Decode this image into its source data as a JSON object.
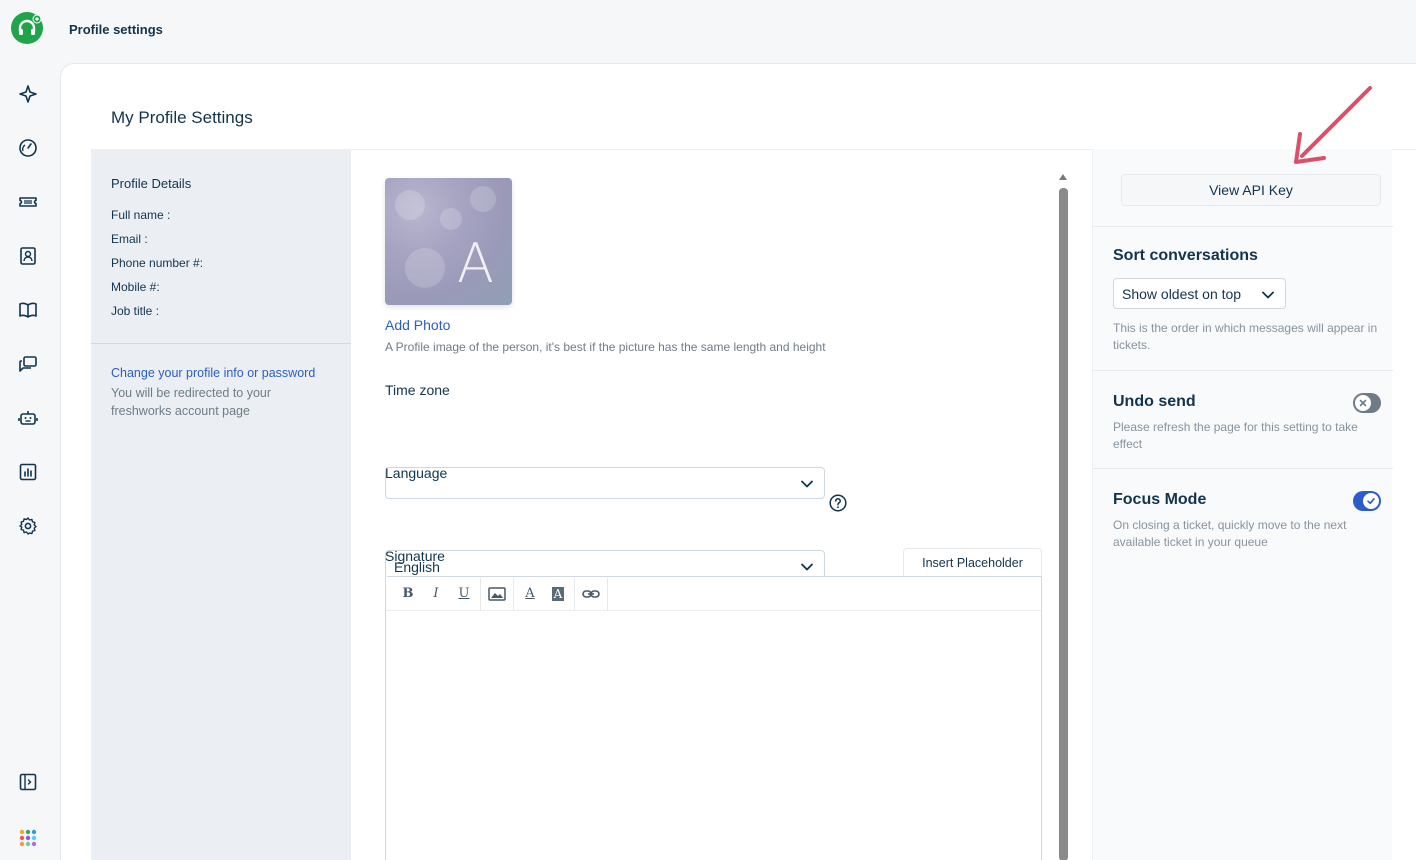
{
  "header": {
    "title": "Profile settings"
  },
  "page": {
    "heading": "My Profile Settings"
  },
  "profile_details": {
    "title": "Profile Details",
    "fields": [
      "Full name :",
      "Email :",
      "Phone number #:",
      "Mobile #:",
      "Job title :"
    ],
    "change_link": "Change your profile info or password",
    "redirect_note": "You will be redirected to your freshworks account page"
  },
  "photo": {
    "initial": "A",
    "add_label": "Add Photo",
    "hint": "A Profile image of the person, it's best if the picture has the same length and height"
  },
  "timezone": {
    "label": "Time zone",
    "value": ""
  },
  "language": {
    "label": "Language",
    "value": "English"
  },
  "signature": {
    "label": "Signature",
    "insert_placeholder": "Insert Placeholder",
    "toolbar": {
      "bold": "B",
      "italic": "I",
      "underline": "U",
      "font_color": "A",
      "bg_color": "A"
    }
  },
  "settings": {
    "api_key_button": "View API Key",
    "sort": {
      "title": "Sort conversations",
      "value": "Show oldest on top",
      "note": "This is the order in which messages will appear in tickets."
    },
    "undo_send": {
      "title": "Undo send",
      "note": "Please refresh the page for this setting to take effect",
      "enabled": false
    },
    "focus_mode": {
      "title": "Focus Mode",
      "note": "On closing a ticket, quickly move to the next available ticket in your queue",
      "enabled": true
    }
  },
  "colors": {
    "accent": "#2c5cc5",
    "brand": "#1fa44b",
    "annotation_arrow": "#d9506a"
  }
}
